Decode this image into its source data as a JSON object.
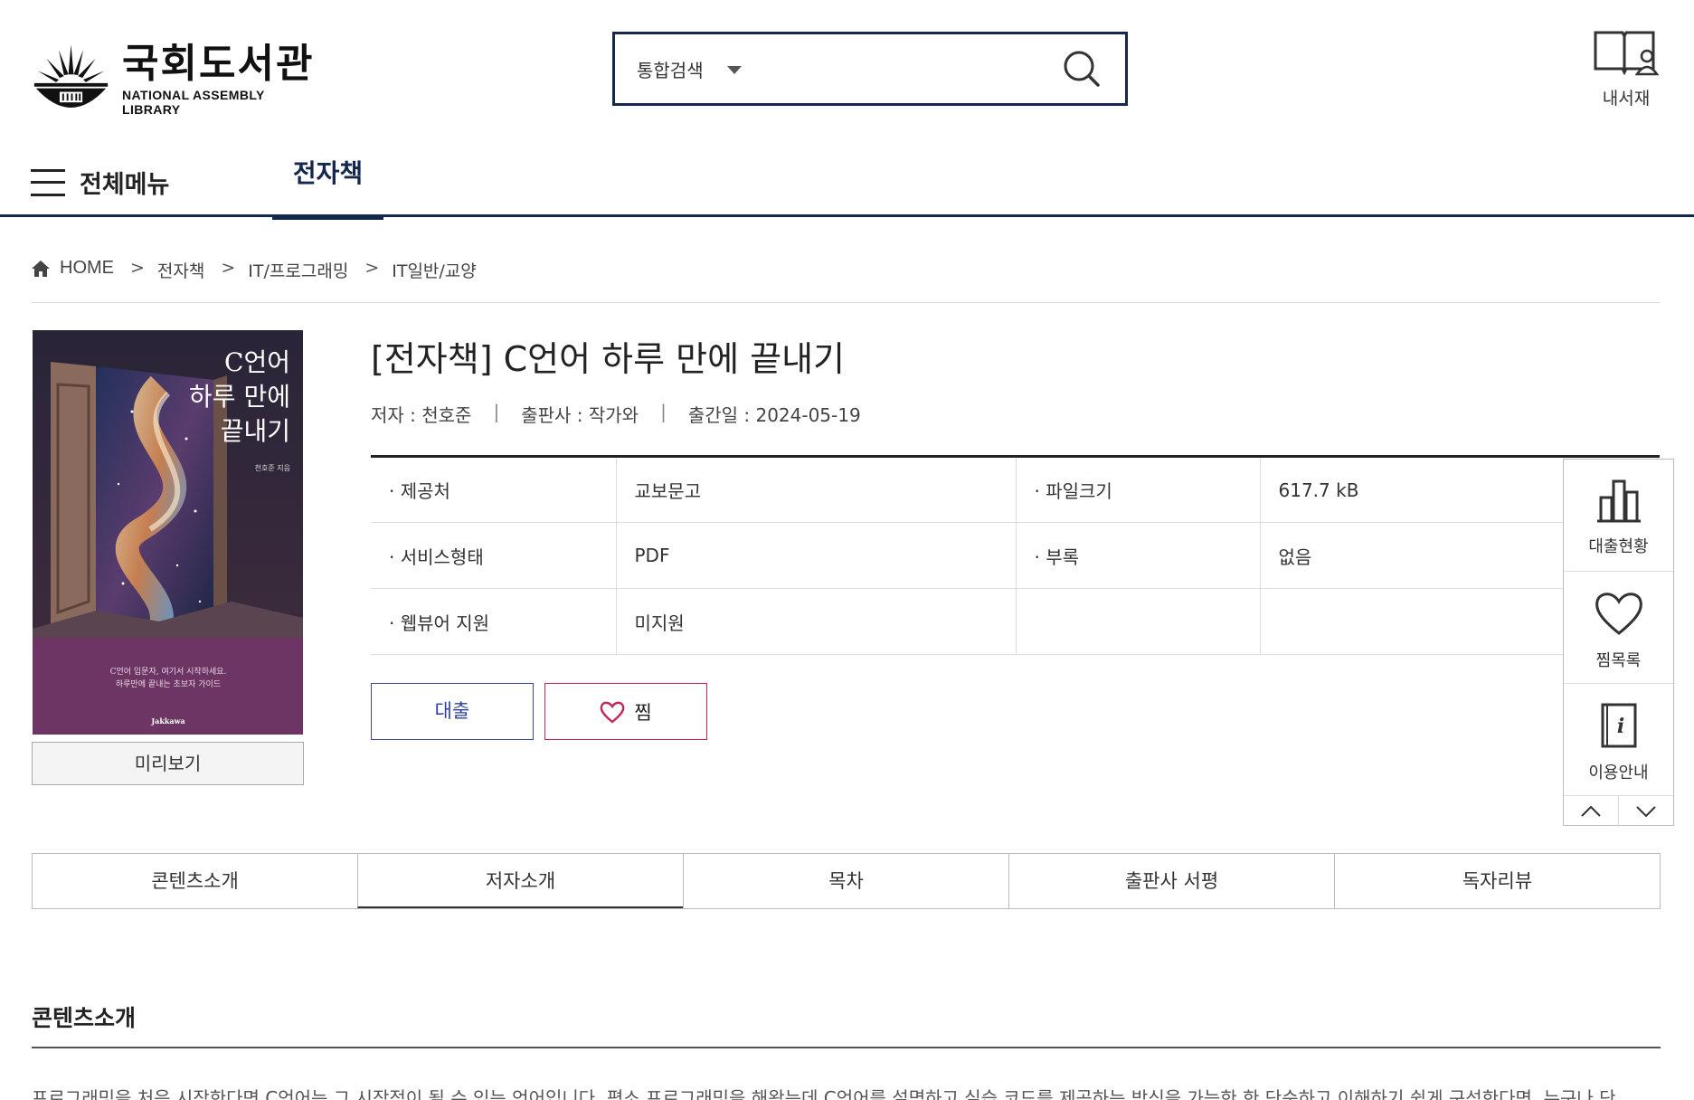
{
  "header": {
    "logo_ko": "국회도서관",
    "logo_en": "NATIONAL ASSEMBLY LIBRARY",
    "search": {
      "scope": "통합검색",
      "value": "",
      "placeholder": ""
    },
    "bookshelf_label": "내서재"
  },
  "gnb": {
    "all_menu": "전체메뉴",
    "active_tab": "전자책"
  },
  "breadcrumb": {
    "home": "HOME",
    "items": [
      "전자책",
      "IT/프로그래밍",
      "IT일반/교양"
    ],
    "separator": ">"
  },
  "cover": {
    "title_line1": "C언어",
    "title_line2": "하루 만에",
    "title_line3": "끝내기",
    "author": "천호준 지음",
    "blurb1": "C언어 입문자, 여기서 시작하세요.",
    "blurb2": "하루만에 끝내는 초보자 가이드",
    "publisher": "Jakkawa",
    "preview_button": "미리보기"
  },
  "book": {
    "title": "[전자책] C언어 하루 만에 끝내기",
    "author": "저자 : 천호준",
    "publisher": "출판사 : 작가와",
    "pub_date": "출간일 : 2024-05-19",
    "meta_sep": "|"
  },
  "info": [
    {
      "k1": "· 제공처",
      "v1": "교보문고",
      "k2": "· 파일크기",
      "v2": "617.7 kB"
    },
    {
      "k1": "· 서비스형태",
      "v1": "PDF",
      "k2": "· 부록",
      "v2": "없음"
    },
    {
      "k1": "· 웹뷰어 지원",
      "v1": "미지원",
      "k2": "",
      "v2": ""
    }
  ],
  "actions": {
    "loan": "대출",
    "wish": "찜"
  },
  "quick_menu": [
    "대출현황",
    "찜목록",
    "이용안내"
  ],
  "tabs": [
    "콘텐츠소개",
    "저자소개",
    "목차",
    "출판사 서평",
    "독자리뷰"
  ],
  "active_tab_index": 1,
  "section": {
    "title": "콘텐츠소개",
    "text": "프로그래밍을 처음 시작한다면 C언어는 그 시작점이 될 수 있는 언어입니다. 평소 프로그래밍을 해왔는데 C언어를 설명하고 실습 코드를 제공하는 방식을 가능한 한 단순하고 이해하기 쉽게 구성한다면, 누구나 단"
  },
  "colors": {
    "navy": "#15274d",
    "loan_blue": "#2e3f9e",
    "wish_pink": "#c4245c",
    "cover_purple": "#6c3563"
  }
}
